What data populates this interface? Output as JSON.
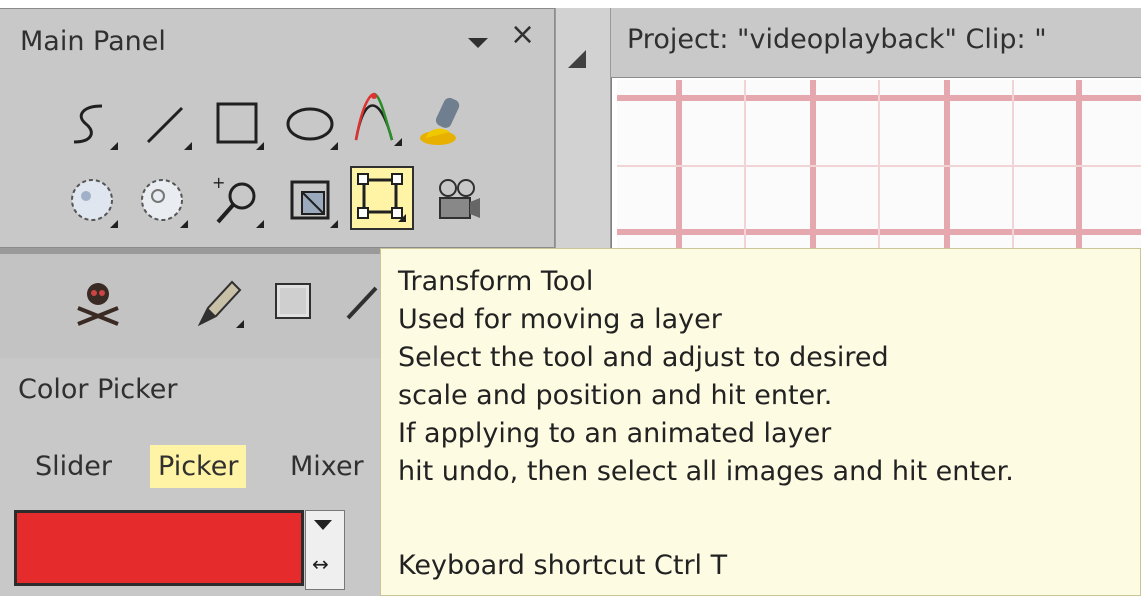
{
  "main_panel": {
    "title": "Main Panel",
    "close_glyph": "×",
    "tools_row1": [
      {
        "name": "freehand-selection-icon"
      },
      {
        "name": "line-tool-icon"
      },
      {
        "name": "rectangle-tool-icon"
      },
      {
        "name": "ellipse-tool-icon"
      },
      {
        "name": "bezier-curve-tool-icon"
      },
      {
        "name": "fill-bucket-icon"
      }
    ],
    "tools_row2": [
      {
        "name": "lasso-selection-icon"
      },
      {
        "name": "magic-lasso-icon"
      },
      {
        "name": "zoom-tool-icon"
      },
      {
        "name": "crop-tool-icon"
      },
      {
        "name": "transform-tool-icon",
        "selected": true
      },
      {
        "name": "camera-tool-icon"
      }
    ],
    "tools_row3": [
      {
        "name": "skull-crossbones-icon"
      },
      {
        "name": "pen-tool-icon"
      },
      {
        "name": "texture-tool-icon"
      },
      {
        "name": "eyedropper-icon"
      }
    ]
  },
  "color_picker": {
    "title": "Color Picker",
    "tabs": [
      {
        "label": "Slider",
        "active": false
      },
      {
        "label": "Picker",
        "active": true
      },
      {
        "label": "Mixer",
        "active": false
      }
    ],
    "current_color": "#e52b2b",
    "swap_glyph": "↔"
  },
  "project_window": {
    "title": "Project:  \"videoplayback\"  Clip: \""
  },
  "tooltip": {
    "lines": [
      "Transform Tool",
      "Used for moving a layer",
      "Select the tool and adjust to desired",
      "scale and position and hit enter.",
      "If applying to an animated layer",
      "hit undo, then select all images and hit enter.",
      "",
      "Keyboard shortcut Ctrl T"
    ]
  },
  "colors": {
    "panel_bg": "#c8c8c8",
    "tooltip_bg": "#fdfbe2",
    "selected_tool_bg": "#fff3a6"
  }
}
